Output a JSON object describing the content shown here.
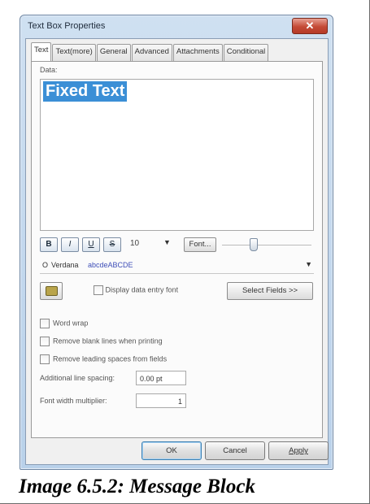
{
  "window": {
    "title": "Text Box Properties",
    "close_glyph": "✕"
  },
  "tabs": [
    {
      "label": "Text",
      "active": true
    },
    {
      "label": "Text(more)"
    },
    {
      "label": "General"
    },
    {
      "label": "Advanced"
    },
    {
      "label": "Attachments"
    },
    {
      "label": "Conditional"
    }
  ],
  "data_section": {
    "label": "Data:",
    "value": "Fixed Text"
  },
  "format_bar": {
    "bold": "B",
    "italic": "I",
    "underline": "U",
    "strike": "S",
    "font_size": "10",
    "font_button": "Font...",
    "slider_level": 0.35
  },
  "font_row": {
    "icon": "O",
    "font_name": "Verdana",
    "sample": "abcdeABCDE"
  },
  "display_checkbox": {
    "label": "Display data entry font",
    "checked": false
  },
  "select_fields_button": "Select Fields >>",
  "options": [
    {
      "label": "Word wrap",
      "checked": false
    },
    {
      "label": "Remove blank lines when printing",
      "checked": false
    },
    {
      "label": "Remove leading spaces from fields",
      "checked": false
    }
  ],
  "line_spacing": {
    "label": "Additional line spacing:",
    "value": "0.00 pt"
  },
  "font_width": {
    "label": "Font width multiplier:",
    "value": "1"
  },
  "buttons": {
    "ok": "OK",
    "cancel": "Cancel",
    "apply": "Apply"
  },
  "caption": "Image 6.5.2: Message Block",
  "colors": {
    "selection": "#3b8fd6",
    "close_button": "#c44a36",
    "sample_text": "#3f4fb8"
  }
}
